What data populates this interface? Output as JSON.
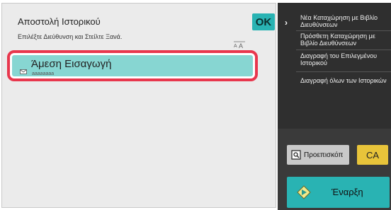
{
  "panel": {
    "title": "Αποστολή Ιστορικού",
    "instruction": "Επιλέξτε Διεύθυνση και Στείλτε Ξανά.",
    "ok_label": "OK",
    "sort_icon": "sort-icon"
  },
  "history": {
    "items": [
      {
        "name": "Άμεση Εισαγωγή",
        "sub": "aaaaaaaa",
        "icon": "mail-icon",
        "selected": true
      }
    ]
  },
  "menu": {
    "items": [
      {
        "label": "Νέα Καταχώρηση με Βιβλίο Διευθύνσεων"
      },
      {
        "label": "Πρόσθετη Καταχώρηση με Βιβλίο Διευθύνσεων"
      },
      {
        "label": "Διαγραφή του Επιλεγμένου Ιστορικού"
      },
      {
        "label": "Διαγραφή όλων των Ιστορικών"
      }
    ]
  },
  "actions": {
    "preview_label": "Προεπισκόπ",
    "ca_label": "CA",
    "start_label": "Έναρξη"
  },
  "colors": {
    "accent": "#29b3b3",
    "selection_border": "#e8374d",
    "ca": "#e8c43a",
    "menu_bg": "#2f2f2f"
  }
}
